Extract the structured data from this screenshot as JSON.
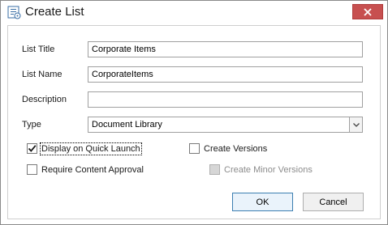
{
  "window": {
    "title": "Create List"
  },
  "form": {
    "list_title_label": "List Title",
    "list_title_value": "Corporate Items",
    "list_name_label": "List Name",
    "list_name_value": "CorporateItems",
    "description_label": "Description",
    "description_value": "",
    "type_label": "Type",
    "type_value": "Document Library"
  },
  "options": {
    "display_quick_launch": {
      "label": "Display on Quick Launch",
      "checked": true
    },
    "create_versions": {
      "label": "Create Versions",
      "checked": false
    },
    "require_content_approval": {
      "label": "Require Content Approval",
      "checked": false
    },
    "create_minor_versions": {
      "label": "Create Minor Versions",
      "checked": false,
      "disabled": true
    }
  },
  "buttons": {
    "ok": "OK",
    "cancel": "Cancel"
  },
  "icons": {
    "title": "list-settings-icon",
    "close": "close-icon",
    "dropdown": "chevron-down-icon",
    "check": "checkmark-icon"
  },
  "colors": {
    "close_button": "#c75050",
    "accent": "#3c7fb1"
  }
}
